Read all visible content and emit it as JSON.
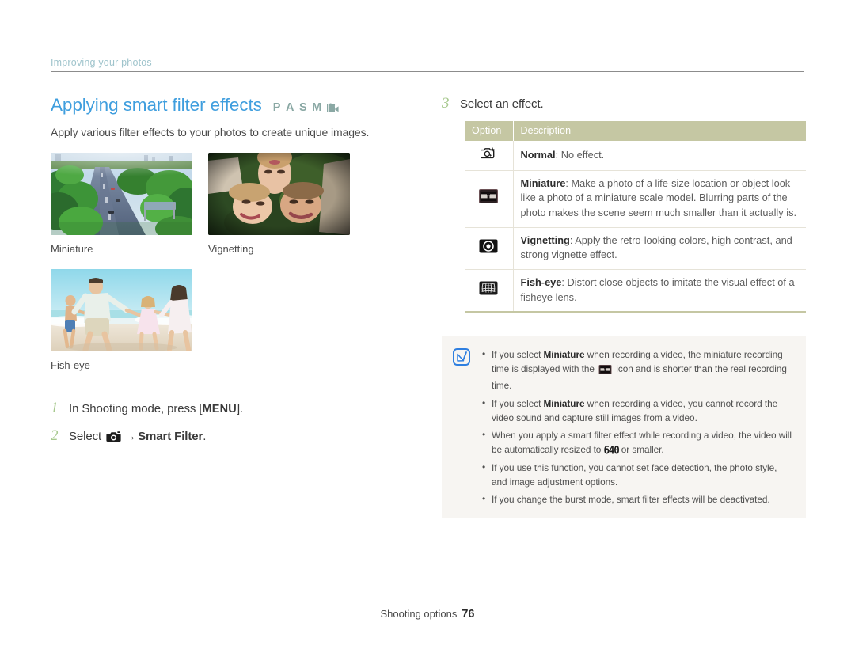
{
  "running_header": {
    "text": "Improving your photos"
  },
  "heading": {
    "title": "Applying smart filter effects",
    "modes": [
      "P",
      "A",
      "S",
      "M"
    ],
    "video_mode_icon": "video-camera-icon",
    "lede": "Apply various filter effects to your photos to create unique images."
  },
  "samples": [
    {
      "caption": "Miniature",
      "image": "aerial-highway-photo"
    },
    {
      "caption": "Vignetting",
      "image": "three-faces-on-grass-photo"
    },
    {
      "caption": "Fish-eye",
      "image": "family-running-on-beach-photo"
    }
  ],
  "steps": [
    {
      "number": "1",
      "text_before": "In Shooting mode, press [",
      "key": "MENU",
      "text_after": "]."
    },
    {
      "number": "2",
      "text_before": "Select",
      "icon": "camera-icon",
      "arrow": "→",
      "bold": "Smart Filter",
      "text_after": "."
    }
  ],
  "step3": {
    "number": "3",
    "text": "Select an effect."
  },
  "table": {
    "headers": {
      "option": "Option",
      "description": "Description"
    },
    "rows": [
      {
        "icon": "camera-sparkle-icon",
        "name": "Normal",
        "description": ": No effect."
      },
      {
        "icon": "miniature-icon",
        "name": "Miniature",
        "description": ": Make a photo of a life-size location or object look like a photo of a miniature scale model. Blurring parts of the photo makes the scene seem much smaller than it actually is."
      },
      {
        "icon": "vignetting-icon",
        "name": "Vignetting",
        "description": ": Apply the retro-looking colors, high contrast, and strong vignette effect."
      },
      {
        "icon": "fisheye-icon",
        "name": "Fish-eye",
        "description": ": Distort close objects to imitate the visual effect of a fisheye lens."
      }
    ]
  },
  "notes": {
    "icon": "note-pen-icon",
    "items": [
      {
        "parts": [
          {
            "t": "text",
            "v": "If you select "
          },
          {
            "t": "bold",
            "v": "Miniature"
          },
          {
            "t": "text",
            "v": " when recording a video, the miniature recording time is displayed with the "
          },
          {
            "t": "icon",
            "v": "miniature-icon"
          },
          {
            "t": "text",
            "v": " icon and is shorter than the real recording time."
          }
        ]
      },
      {
        "parts": [
          {
            "t": "text",
            "v": "If you select "
          },
          {
            "t": "bold",
            "v": "Miniature"
          },
          {
            "t": "text",
            "v": " when recording a video, you cannot record the video sound and capture still images from a video."
          }
        ]
      },
      {
        "parts": [
          {
            "t": "text",
            "v": "When you apply a smart filter effect while recording a video, the video will be automatically resized to "
          },
          {
            "t": "res",
            "v": "640"
          },
          {
            "t": "text",
            "v": " or smaller."
          }
        ]
      },
      {
        "parts": [
          {
            "t": "text",
            "v": "If you use this function, you cannot set face detection, the photo style, and image adjustment options."
          }
        ]
      },
      {
        "parts": [
          {
            "t": "text",
            "v": "If you change the burst mode, smart filter effects will be deactivated."
          }
        ]
      }
    ]
  },
  "footer": {
    "section": "Shooting options",
    "page": "76"
  },
  "colors": {
    "title_blue": "#3f9ede",
    "running_header": "#9fc4cc",
    "mode_icons": "#8aa8a4",
    "step_number_green": "#a8c98f",
    "table_header_bg": "#c5c7a3",
    "note_bg": "#f7f5f2",
    "note_icon_blue": "#2f7fe0"
  }
}
